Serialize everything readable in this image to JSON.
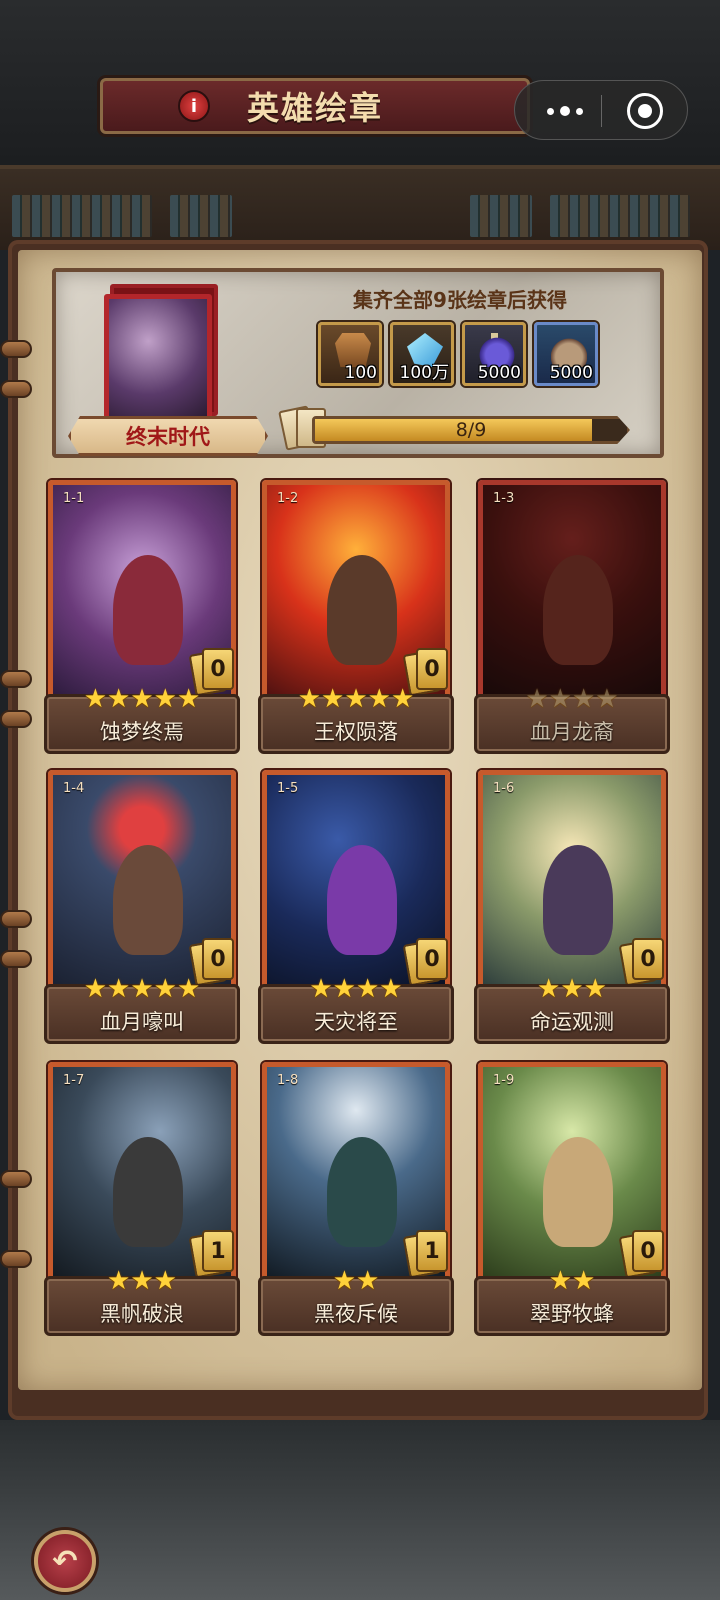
{
  "header": {
    "title": "英雄绘章",
    "info_icon": "info-icon",
    "more_icon": "more-dots-icon",
    "close_icon": "target-icon"
  },
  "reward": {
    "set_name": "终末时代",
    "title": "集齐全部9张绘章后获得",
    "items": [
      {
        "icon": "armor-icon",
        "qty": "100"
      },
      {
        "icon": "crystal-icon",
        "qty": "100万"
      },
      {
        "icon": "potion-icon",
        "qty": "5000"
      },
      {
        "icon": "ore-icon",
        "qty": "5000"
      }
    ],
    "progress_text": "8/9",
    "progress_fraction": 0.889
  },
  "cards": [
    {
      "num": "1-1",
      "name": "蚀梦终焉",
      "stars": "★★★★★",
      "count": "0",
      "owned": true
    },
    {
      "num": "1-2",
      "name": "王权陨落",
      "stars": "★★★★★",
      "count": "0",
      "owned": true
    },
    {
      "num": "1-3",
      "name": "血月龙裔",
      "stars": "★★★★",
      "count": "",
      "owned": false
    },
    {
      "num": "1-4",
      "name": "血月嚎叫",
      "stars": "★★★★★",
      "count": "0",
      "owned": true
    },
    {
      "num": "1-5",
      "name": "天灾将至",
      "stars": "★★★★",
      "count": "0",
      "owned": true
    },
    {
      "num": "1-6",
      "name": "命运观测",
      "stars": "★★★",
      "count": "0",
      "owned": true
    },
    {
      "num": "1-7",
      "name": "黑帆破浪",
      "stars": "★★★",
      "count": "1",
      "owned": true
    },
    {
      "num": "1-8",
      "name": "黑夜斥候",
      "stars": "★★",
      "count": "1",
      "owned": true
    },
    {
      "num": "1-9",
      "name": "翠野牧蜂",
      "stars": "★★",
      "count": "0",
      "owned": true
    }
  ],
  "footer": {
    "back_icon": "back-arrow-icon",
    "back_glyph": "↶"
  }
}
